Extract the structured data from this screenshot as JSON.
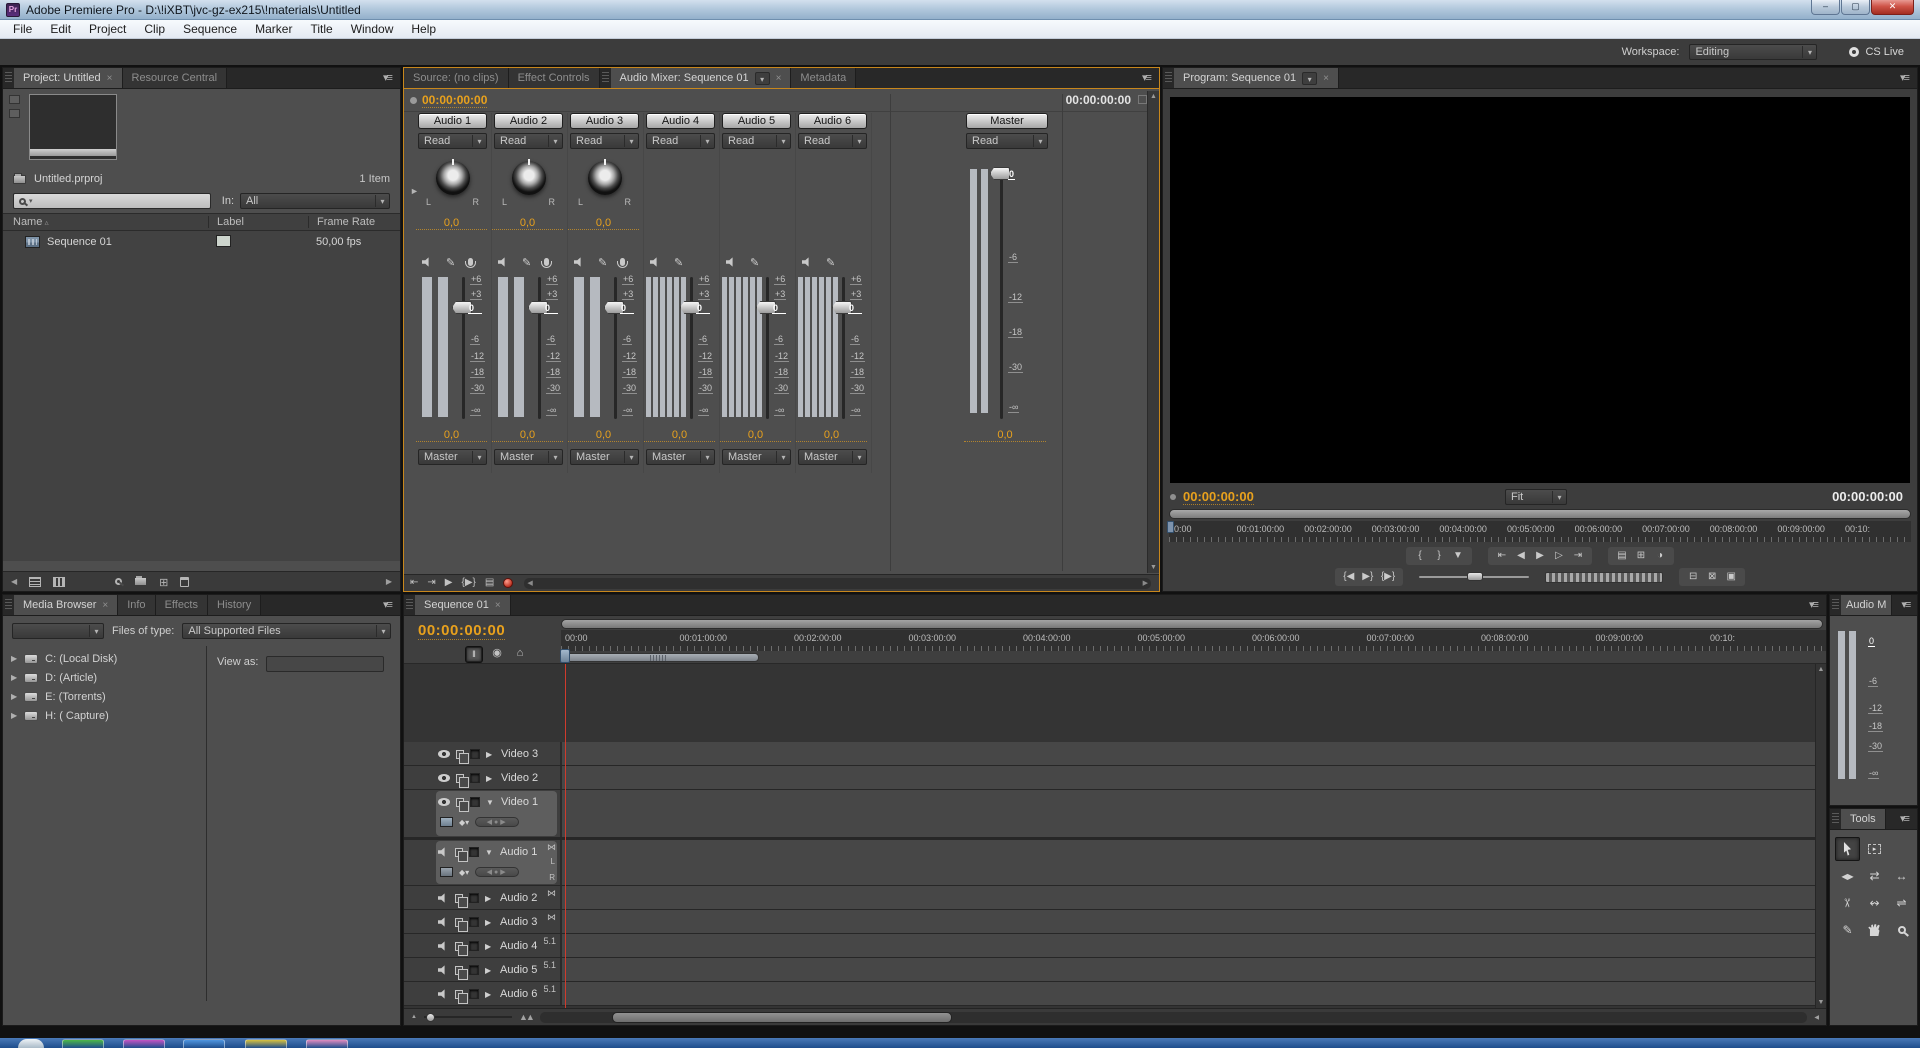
{
  "window": {
    "icon_text": "Pr",
    "title": "Adobe Premiere Pro - D:\\!iXBT\\jvc-gz-ex215\\!materials\\Untitled",
    "minimize": "–",
    "maximize": "▢",
    "close": "✕"
  },
  "menu_bar": {
    "items": [
      "File",
      "Edit",
      "Project",
      "Clip",
      "Sequence",
      "Marker",
      "Title",
      "Window",
      "Help"
    ]
  },
  "workspace_bar": {
    "label": "Workspace:",
    "value": "Editing",
    "cs_live": "CS Live"
  },
  "project_panel": {
    "tabs": [
      "Project: Untitled",
      "Resource Central"
    ],
    "file_name": "Untitled.prproj",
    "item_count": "1 Item",
    "in_label": "In:",
    "in_value": "All",
    "columns": {
      "name": "Name",
      "label": "Label",
      "frame_rate": "Frame Rate"
    },
    "rows": [
      {
        "name": "Sequence 01",
        "frame_rate": "50,00 fps"
      }
    ]
  },
  "mixer_panel": {
    "tabs": [
      "Source: (no clips)",
      "Effect Controls",
      "Audio Mixer: Sequence 01",
      "Metadata"
    ],
    "timecode_left": "00:00:00:00",
    "timecode_right": "00:00:00:00",
    "pan_left": "L",
    "pan_right": "R",
    "fader_scale": [
      "+6",
      "+3",
      "0",
      "-6",
      "-12",
      "-18",
      "-30",
      "-∞"
    ],
    "master_scale": [
      "0",
      "-6",
      "-12",
      "-18",
      "-30",
      "-∞"
    ],
    "tracks": [
      {
        "name": "Audio 1",
        "automation": "Read",
        "stereo": true,
        "record": true,
        "pan": "0,0",
        "value": "0,0",
        "output": "Master"
      },
      {
        "name": "Audio 2",
        "automation": "Read",
        "stereo": true,
        "record": true,
        "pan": "0,0",
        "value": "0,0",
        "output": "Master"
      },
      {
        "name": "Audio 3",
        "automation": "Read",
        "stereo": true,
        "record": true,
        "pan": "0,0",
        "value": "0,0",
        "output": "Master"
      },
      {
        "name": "Audio 4",
        "automation": "Read",
        "six": true,
        "value": "0,0",
        "output": "Master"
      },
      {
        "name": "Audio 5",
        "automation": "Read",
        "six": true,
        "value": "0,0",
        "output": "Master"
      },
      {
        "name": "Audio 6",
        "automation": "Read",
        "six": true,
        "value": "0,0",
        "output": "Master"
      }
    ],
    "master": {
      "name": "Master",
      "automation": "Read",
      "value": "0,0"
    }
  },
  "program_panel": {
    "tab": "Program: Sequence 01",
    "timecode_left": "00:00:00:00",
    "fit": "Fit",
    "timecode_right": "00:00:00:00",
    "ruler": [
      "00:00",
      "00:01:00:00",
      "00:02:00:00",
      "00:03:00:00",
      "00:04:00:00",
      "00:05:00:00",
      "00:06:00:00",
      "00:07:00:00",
      "00:08:00:00",
      "00:09:00:00",
      "00:10:"
    ]
  },
  "media_panel": {
    "tabs": [
      "Media Browser",
      "Info",
      "Effects",
      "History"
    ],
    "files_of_type_label": "Files of type:",
    "files_of_type_value": "All Supported Files",
    "view_as_label": "View as:",
    "drives": [
      {
        "name": "C: (Local Disk)"
      },
      {
        "name": "D: (Article)"
      },
      {
        "name": "E: (Torrents)"
      },
      {
        "name": "H: ( Capture)"
      }
    ]
  },
  "timeline_panel": {
    "tab": "Sequence 01",
    "timecode": "00:00:00:00",
    "ruler": [
      "00:00",
      "00:01:00:00",
      "00:02:00:00",
      "00:03:00:00",
      "00:04:00:00",
      "00:05:00:00",
      "00:06:00:00",
      "00:07:00:00",
      "00:08:00:00",
      "00:09:00:00",
      "00:10:"
    ],
    "video_tracks_simple": [
      {
        "name": "Video 3"
      },
      {
        "name": "Video 2"
      }
    ],
    "video1": {
      "name": "Video 1"
    },
    "audio1": {
      "name": "Audio 1",
      "badge": "⋈",
      "left": "L",
      "right": "R"
    },
    "audio_tracks_simple": [
      {
        "name": "Audio 2",
        "badge": "⋈"
      },
      {
        "name": "Audio 3",
        "badge": "⋈"
      },
      {
        "name": "Audio 4",
        "badge": "5.1"
      },
      {
        "name": "Audio 5",
        "badge": "5.1"
      },
      {
        "name": "Audio 6",
        "badge": "5.1"
      }
    ]
  },
  "meters_panel": {
    "title": "Audio M",
    "scale": [
      "0",
      "-6",
      "-12",
      "-18",
      "-30",
      "-∞"
    ]
  },
  "tools_panel": {
    "title": "Tools"
  },
  "taskbar": {
    "colors": [
      "#4db848",
      "#c455c4",
      "#4f96e0",
      "#d8c23f",
      "#e08cc0"
    ]
  }
}
